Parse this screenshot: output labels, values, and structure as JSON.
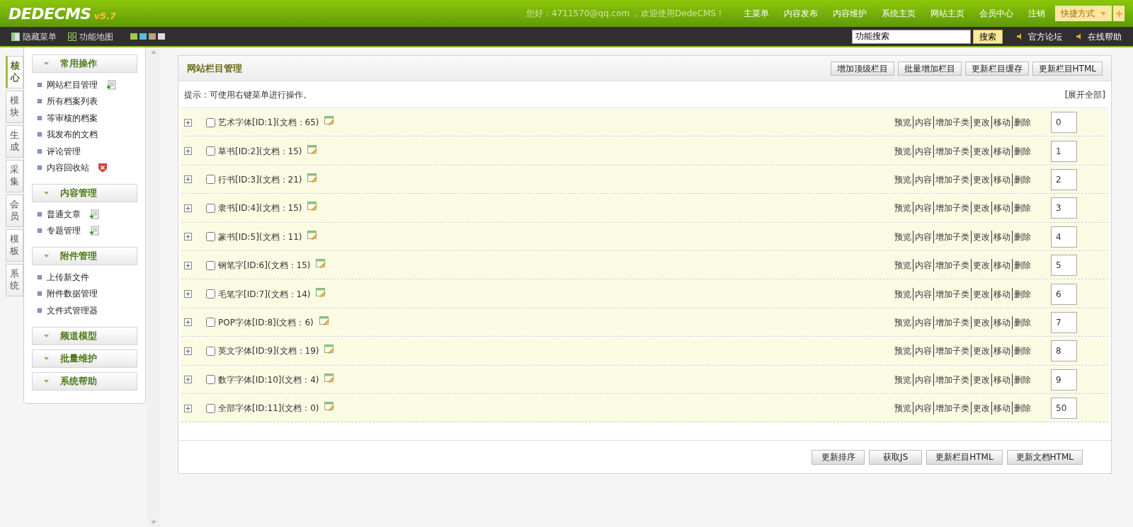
{
  "header": {
    "logo": "DEDECMS",
    "version": "v5.7",
    "greeting": "您好：4711570@qq.com ，欢迎使用DedeCMS！",
    "nav": [
      "主菜单",
      "内容发布",
      "内容维护",
      "系统主页",
      "网站主页",
      "会员中心",
      "注销"
    ],
    "shortcut": "快捷方式"
  },
  "toolbar": {
    "items": [
      {
        "label": "隐藏菜单",
        "kind": "panel"
      },
      {
        "label": "功能地图",
        "kind": "grid"
      }
    ],
    "skins": [
      {
        "color": "#a6c93f"
      },
      {
        "color": "#5cb7e3"
      },
      {
        "color": "#b9a27e"
      },
      {
        "color": "#dcdcdc"
      }
    ],
    "search": {
      "value": "功能搜索"
    },
    "search_button": "搜索",
    "links": [
      "官方论坛",
      "在线帮助"
    ]
  },
  "side_tabs": [
    {
      "label": "核心",
      "selected": true
    },
    {
      "label": "模块",
      "selected": false
    },
    {
      "label": "生成",
      "selected": false
    },
    {
      "label": "采集",
      "selected": false
    },
    {
      "label": "会员",
      "selected": false
    },
    {
      "label": "模板",
      "selected": false
    },
    {
      "label": "系统",
      "selected": false
    }
  ],
  "menu": [
    {
      "title": "常用操作",
      "items": [
        {
          "label": "网站栏目管理",
          "kind": "add"
        },
        {
          "label": "所有档案列表"
        },
        {
          "label": "等审核的档案"
        },
        {
          "label": "我发布的文档"
        },
        {
          "label": "评论管理"
        },
        {
          "label": "内容回收站",
          "kind": "delete"
        }
      ]
    },
    {
      "title": "内容管理",
      "items": [
        {
          "label": "普通文章",
          "kind": "add"
        },
        {
          "label": "专题管理",
          "kind": "add"
        }
      ]
    },
    {
      "title": "附件管理",
      "items": [
        {
          "label": "上传新文件"
        },
        {
          "label": "附件数据管理"
        },
        {
          "label": "文件式管理器"
        }
      ]
    },
    {
      "title": "频道模型"
    },
    {
      "title": "批量维护"
    },
    {
      "title": "系统帮助"
    }
  ],
  "panel": {
    "title": "网站栏目管理",
    "buttons": [
      "增加顶级栏目",
      "批量增加栏目",
      "更新栏目缓存",
      "更新栏目HTML"
    ],
    "hint": "提示：可使用右键菜单进行操作。",
    "expand_all": "[展开全部]",
    "rows": [
      {
        "name": "艺术字体[ID:1](文档：65)",
        "checked": false,
        "actions": [
          "预览",
          "内容",
          "增加子类",
          "更改",
          "移动",
          "删除"
        ],
        "order": "0"
      },
      {
        "name": "草书[ID:2](文档：15)",
        "checked": false,
        "actions": [
          "预览",
          "内容",
          "增加子类",
          "更改",
          "移动",
          "删除"
        ],
        "order": "1"
      },
      {
        "name": "行书[ID:3](文档：21)",
        "checked": false,
        "actions": [
          "预览",
          "内容",
          "增加子类",
          "更改",
          "移动",
          "删除"
        ],
        "order": "2"
      },
      {
        "name": "隶书[ID:4](文档：15)",
        "checked": false,
        "actions": [
          "预览",
          "内容",
          "增加子类",
          "更改",
          "移动",
          "删除"
        ],
        "order": "3"
      },
      {
        "name": "篆书[ID:5](文档：11)",
        "checked": false,
        "actions": [
          "预览",
          "内容",
          "增加子类",
          "更改",
          "移动",
          "删除"
        ],
        "order": "4"
      },
      {
        "name": "钢笔字[ID:6](文档：15)",
        "checked": false,
        "actions": [
          "预览",
          "内容",
          "增加子类",
          "更改",
          "移动",
          "删除"
        ],
        "order": "5"
      },
      {
        "name": "毛笔字[ID:7](文档：14)",
        "checked": false,
        "actions": [
          "预览",
          "内容",
          "增加子类",
          "更改",
          "移动",
          "删除"
        ],
        "order": "6"
      },
      {
        "name": "POP字体[ID:8](文档：6)",
        "checked": false,
        "actions": [
          "预览",
          "内容",
          "增加子类",
          "更改",
          "移动",
          "删除"
        ],
        "order": "7"
      },
      {
        "name": "英文字体[ID:9](文档：19)",
        "checked": false,
        "actions": [
          "预览",
          "内容",
          "增加子类",
          "更改",
          "移动",
          "删除"
        ],
        "order": "8"
      },
      {
        "name": "数字字体[ID:10](文档：4)",
        "checked": false,
        "actions": [
          "预览",
          "内容",
          "增加子类",
          "更改",
          "移动",
          "删除"
        ],
        "order": "9"
      },
      {
        "name": "全部字体[ID:11](文档：0)",
        "checked": false,
        "actions": [
          "预览",
          "内容",
          "增加子类",
          "更改",
          "移动",
          "删除"
        ],
        "order": "50"
      }
    ],
    "footer_buttons": [
      "更新排序",
      "获取JS",
      "更新栏目HTML",
      "更新文档HTML"
    ]
  }
}
